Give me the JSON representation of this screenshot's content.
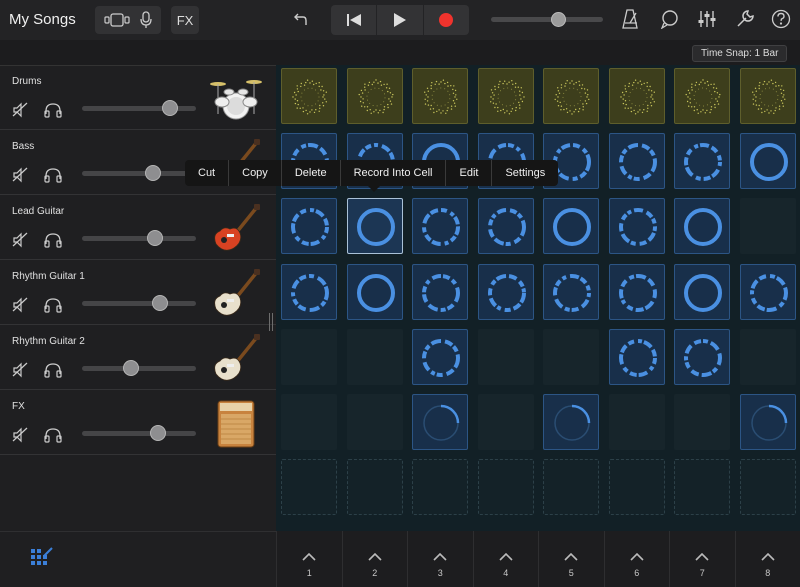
{
  "app": {
    "title": "My Songs",
    "fx_label": "FX",
    "time_snap": "Time Snap: 1 Bar",
    "master_volume": 0.6
  },
  "colors": {
    "accent_blue": "#4a90e2",
    "drum_yellow": "#b8b450",
    "record_red": "#f0332d"
  },
  "tracks": [
    {
      "name": "Drums",
      "volume": 0.77,
      "instrument_icon": "drum-kit-icon"
    },
    {
      "name": "Bass",
      "volume": 0.62,
      "instrument_icon": "bass-guitar-icon"
    },
    {
      "name": "Lead Guitar",
      "volume": 0.64,
      "instrument_icon": "electric-guitar-red-icon"
    },
    {
      "name": "Rhythm Guitar 1",
      "volume": 0.68,
      "instrument_icon": "electric-guitar-sunburst-icon"
    },
    {
      "name": "Rhythm Guitar 2",
      "volume": 0.43,
      "instrument_icon": "electric-guitar-sunburst-icon"
    },
    {
      "name": "FX",
      "volume": 0.67,
      "instrument_icon": "amplifier-icon"
    }
  ],
  "context_menu": [
    "Cut",
    "Copy",
    "Delete",
    "Record Into Cell",
    "Edit",
    "Settings"
  ],
  "columns": [
    "1",
    "2",
    "3",
    "4",
    "5",
    "6",
    "7",
    "8"
  ],
  "grid": [
    [
      "drum",
      "drum",
      "drum",
      "drum",
      "drum",
      "drum",
      "drum",
      "drum"
    ],
    [
      "loop",
      "loop",
      "loop",
      "loop",
      "loop",
      "loop",
      "loop",
      "loop"
    ],
    [
      "loop",
      "selected",
      "loop",
      "loop",
      "loop",
      "loop",
      "loop",
      "empty"
    ],
    [
      "loop",
      "loop",
      "loop",
      "loop",
      "loop",
      "loop",
      "loop",
      "loop"
    ],
    [
      "empty",
      "empty",
      "loop",
      "empty",
      "empty",
      "loop",
      "loop",
      "empty"
    ],
    [
      "empty",
      "empty",
      "partial",
      "empty",
      "partial",
      "empty",
      "empty",
      "partial"
    ],
    [
      "add",
      "add",
      "add",
      "add",
      "add",
      "add",
      "add",
      "add"
    ]
  ]
}
